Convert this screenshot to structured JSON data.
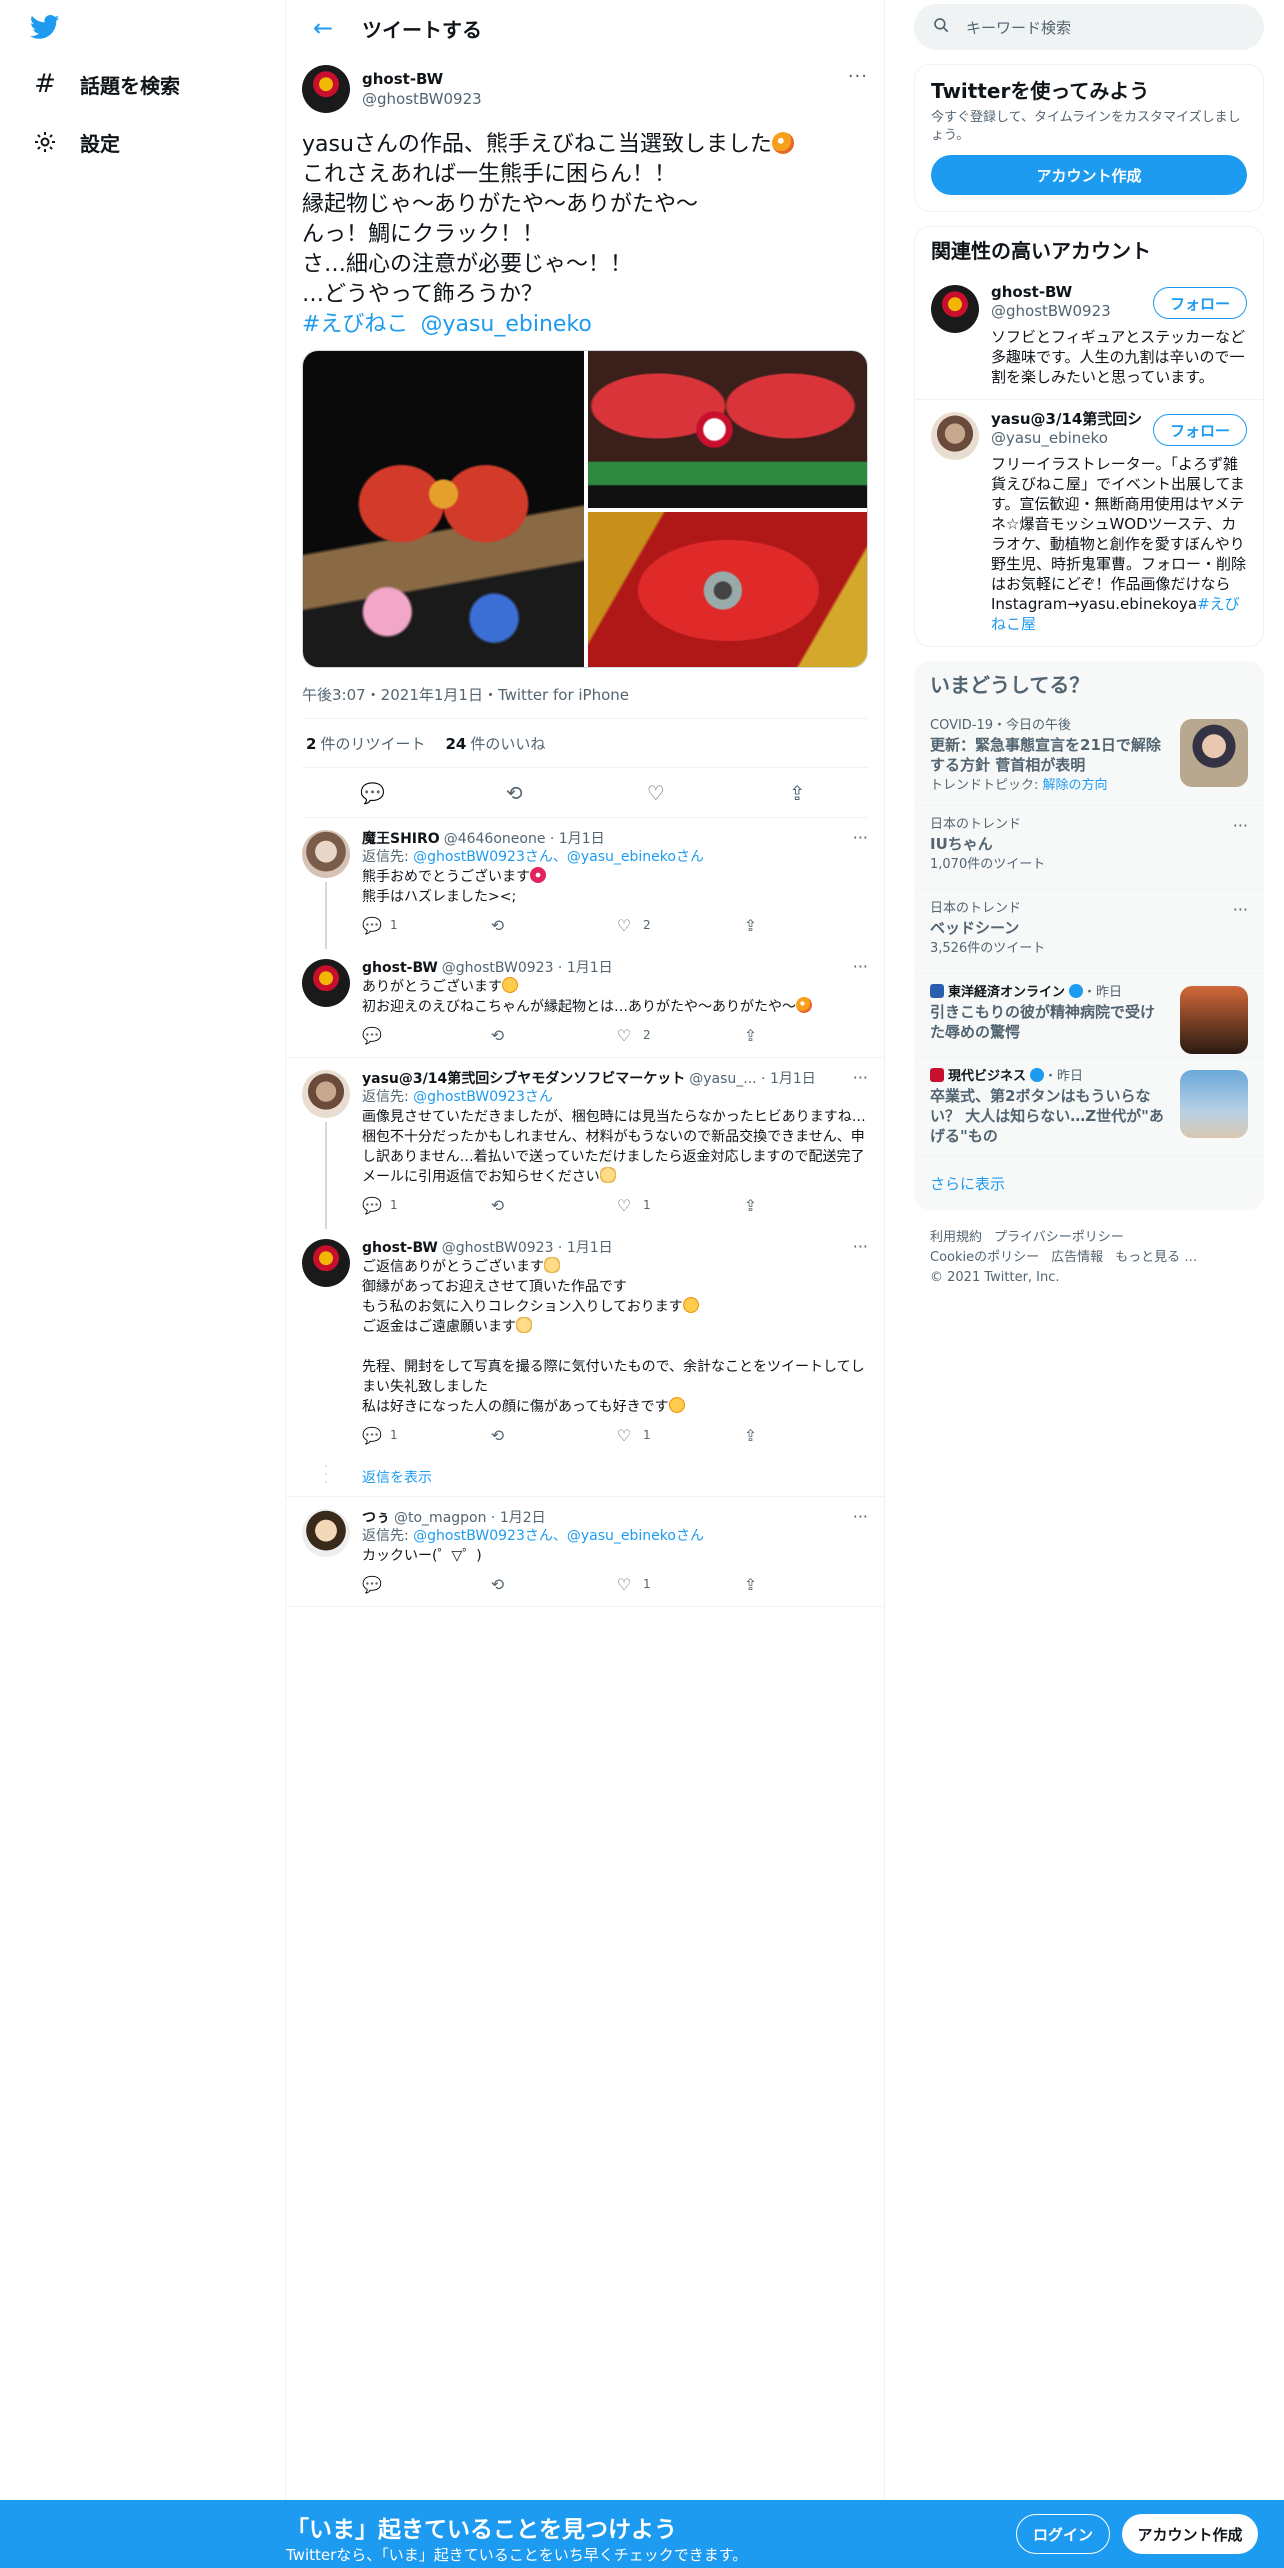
{
  "nav": {
    "items": [
      {
        "icon": "hashtag-icon",
        "label": "話題を検索"
      },
      {
        "icon": "gear-icon",
        "label": "設定"
      }
    ]
  },
  "header": {
    "title": "ツイートする"
  },
  "tweet": {
    "author_name": "ghost-BW",
    "author_handle": "@ghostBW0923",
    "text_line1": "yasuさんの作品、熊手えびねこ当選致しました",
    "text_rest": "これさえあれば一生熊手に困らん！！\n縁起物じゃ〜ありがたや〜ありがたや〜\nんっ！鯛にクラック！！\nさ…細心の注意が必要じゃ〜！！\n…どうやって飾ろうか？",
    "hashtag": "#えびねこ",
    "mention": "@yasu_ebineko",
    "meta": "午後3:07・2021年1月1日・Twitter for iPhone",
    "retweets": "2",
    "retweets_label": "件のリツイート",
    "likes": "24",
    "likes_label": "件のいいね"
  },
  "replies": [
    {
      "name": "魔王SHIRO",
      "handle": "@4646oneone",
      "date": "1月1日",
      "reply_to_label": "返信先:",
      "reply_to": "@ghostBW0923さん、@yasu_ebinekoさん",
      "text": "熊手おめでとうございます",
      "text2": "熊手はハズレました><;",
      "reply": "1",
      "retweet": "",
      "like": "2"
    },
    {
      "name": "ghost-BW",
      "handle": "@ghostBW0923",
      "date": "1月1日",
      "text": "ありがとうございます",
      "text2": "初お迎えのえびねこちゃんが縁起物とは…ありがたや〜ありがたや〜",
      "reply": "",
      "retweet": "",
      "like": "2"
    },
    {
      "name": "yasu@3/14第弐回シブヤモダンソフビマーケット",
      "handle": "@yasu_...",
      "date": "1月1日",
      "reply_to_label": "返信先:",
      "reply_to": "@ghostBW0923さん",
      "text": "画像見させていただきましたが、梱包時には見当たらなかったヒビありますね…梱包不十分だったかもしれません、材料がもうないので新品交換できません、申し訳ありません…着払いで送っていただけましたら返金対応しますので配送完了メールに引用返信でお知らせください",
      "reply": "1",
      "retweet": "",
      "like": "1"
    },
    {
      "name": "ghost-BW",
      "handle": "@ghostBW0923",
      "date": "1月1日",
      "text": "ご返信ありがとうございます",
      "text2": "御縁があってお迎えさせて頂いた作品です\nもう私のお気に入りコレクション入りしております",
      "text3": "ご返金はご遠慮願います",
      "text4": "先程、開封をして写真を撮る際に気付いたもので、余計なことをツイートしてしまい失礼致しました\n私は好きになった人の顔に傷があっても好きです",
      "reply": "1",
      "retweet": "",
      "like": "1"
    },
    {
      "name": "つぅ",
      "handle": "@to_magpon",
      "date": "1月2日",
      "reply_to_label": "返信先:",
      "reply_to": "@ghostBW0923さん、@yasu_ebinekoさん",
      "text": "カックいー(゜▽゜)",
      "reply": "",
      "retweet": "",
      "like": "1"
    }
  ],
  "show_replies": "返信を表示",
  "sidebar": {
    "search_placeholder": "キーワード検索",
    "signup": {
      "title": "Twitterを使ってみよう",
      "desc": "今すぐ登録して、タイムラインをカスタマイズしましょう。",
      "button": "アカウント作成"
    },
    "related": {
      "title": "関連性の高いアカウント",
      "follow_label": "フォロー",
      "accounts": [
        {
          "name": "ghost-BW",
          "handle": "@ghostBW0923",
          "bio": "ソフビとフィギュアとステッカーなど多趣味です。人生の九割は辛いので一割を楽しみたいと思っています。"
        },
        {
          "name": "yasu@3/14第弐回シ...",
          "handle": "@yasu_ebineko",
          "bio": "フリーイラストレーター。「よろず雑貨えびねこ屋」でイベント出展してます。宣伝歓迎・無断商用使用はヤメテネ☆爆音モッシュWODツーステ、カラオケ、動植物と創作を愛すぼんやり野生児、時折鬼軍曹。フォロー・削除はお気軽にどぞ！作品画像だけならInstagram→yasu.ebinekoya",
          "bio_link": "#えびねこ屋"
        }
      ]
    },
    "trends": {
      "title": "いまどうしてる？",
      "items": [
        {
          "context": "COVID-19・今日の午後",
          "name": "更新：緊急事態宣言を21日で解除する方針 菅首相が表明",
          "sub_label": "トレンドトピック:",
          "sub_link": "解除の方向"
        },
        {
          "context": "日本のトレンド",
          "name": "IUちゃん",
          "sub": "1,070件のツイート"
        },
        {
          "context": "日本のトレンド",
          "name": "ベッドシーン",
          "sub": "3,526件のツイート"
        },
        {
          "source": "東洋経済オンライン",
          "time": "・昨日",
          "name": "引きこもりの彼が精神病院で受けた辱めの驚愕"
        },
        {
          "source": "現代ビジネス",
          "time": "・昨日",
          "name": "卒業式、第2ボタンはもういらない？ 大人は知らない…Z世代が\"あげる\"もの"
        }
      ],
      "show_more": "さらに表示"
    },
    "footer": {
      "links": [
        "利用規約",
        "プライバシーポリシー",
        "Cookieのポリシー",
        "広告情報",
        "もっと見る …"
      ],
      "copyright": "© 2021 Twitter, Inc."
    }
  },
  "bottom_bar": {
    "title": "「いま」起きていることを見つけよう",
    "subtitle": "Twitterなら、「いま」起きていることをいち早くチェックできます。",
    "login": "ログイン",
    "signup": "アカウント作成"
  },
  "colors": {
    "accent": "#1d9bf0",
    "text": "#0f1419",
    "secondary": "#536471"
  }
}
